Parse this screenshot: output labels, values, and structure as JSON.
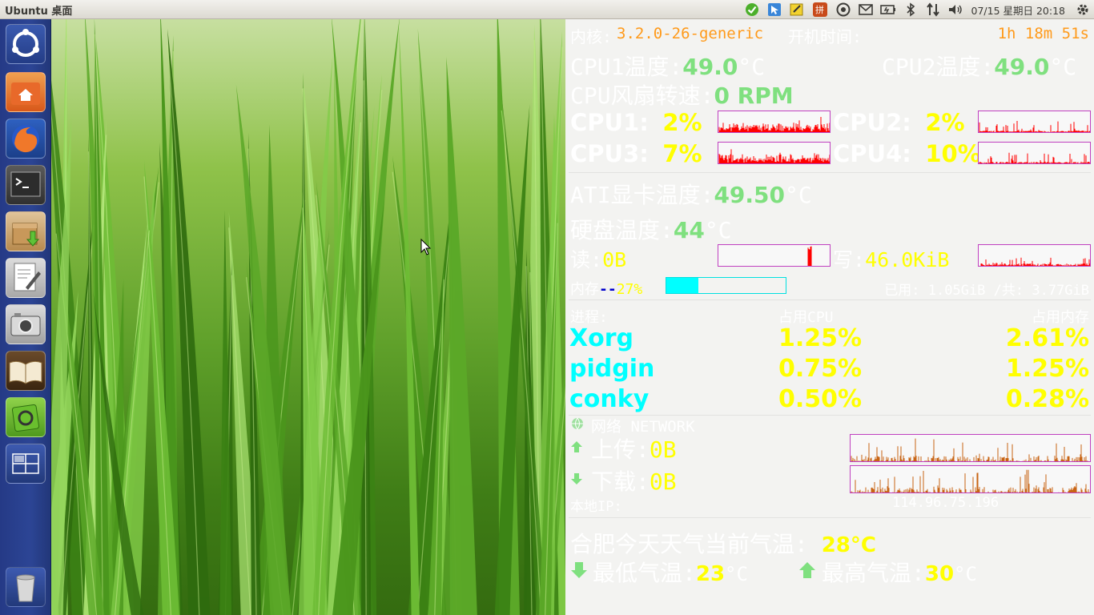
{
  "panel": {
    "title": "Ubuntu 桌面",
    "clock": "07/15 星期日 20:18",
    "tray": [
      "check-icon",
      "network-manager-icon",
      "notes-icon",
      "input-method-icon",
      "ubuntu-one-icon",
      "mail-icon",
      "battery-icon",
      "bluetooth-icon",
      "transfer-icon",
      "volume-icon",
      "power-gear-icon"
    ],
    "input_method_label": "拼"
  },
  "launcher": {
    "items": [
      "ubuntu-dash-icon",
      "home-folder-icon",
      "firefox-icon",
      "terminal-icon",
      "archive-manager-icon",
      "text-editor-icon",
      "screenshot-camera-icon",
      "ebook-reader-icon",
      "software-center-icon",
      "workspace-switcher-icon",
      "trash-icon"
    ]
  },
  "conky": {
    "kernel_label": "内核:",
    "kernel_value": "3.2.0-26-generic",
    "uptime_label": "开机时间:",
    "uptime_value": "1h 18m 51s",
    "cpu1_temp_label": "CPU1温度:",
    "cpu1_temp_value": "49.0",
    "cpu2_temp_label": "CPU2温度:",
    "cpu2_temp_value": "49.0",
    "temp_unit": "°C",
    "fan_label": "CPU风扇转速:",
    "fan_value": "0 RPM",
    "cpus": [
      {
        "label": "CPU1:",
        "value": "2%"
      },
      {
        "label": "CPU2:",
        "value": "2%"
      },
      {
        "label": "CPU3:",
        "value": "7%"
      },
      {
        "label": "CPU4:",
        "value": "10%"
      }
    ],
    "gpu_temp_label": "ATI显卡温度:",
    "gpu_temp_value": "49.50",
    "disk_temp_label": "硬盘温度:",
    "disk_temp_value": "44",
    "read_label": "读:",
    "read_value": "0B",
    "write_label": "写:",
    "write_value": "46.0KiB",
    "mem_label": "内存",
    "mem_dashes": "--",
    "mem_percent": "27%",
    "mem_fraction": 0.27,
    "mem_used": "已用: 1.05GiB /共: 3.77GiB",
    "proc_header": "进程:",
    "cpu_header": "占用CPU",
    "mem_header": "占用内存",
    "processes": [
      {
        "name": "Xorg",
        "cpu": "1.25%",
        "mem": "2.61%"
      },
      {
        "name": "pidgin",
        "cpu": "0.75%",
        "mem": "1.25%"
      },
      {
        "name": "conky",
        "cpu": "0.50%",
        "mem": "0.28%"
      }
    ],
    "network_label": "网络 NETWORK",
    "upload_label": "上传:",
    "upload_value": "0B",
    "download_label": "下载:",
    "download_value": "0B",
    "local_ip_label": "本地IP:",
    "local_ip_value": "114.96.75.196",
    "weather_label": "合肥今天天气当前气温:",
    "weather_current": "28°C",
    "weather_low_label": "最低气温:",
    "weather_low": "23",
    "weather_high_label": "最高气温:",
    "weather_high": "30",
    "colors": {
      "label": "#ffffff",
      "value_green": "#7fe07f",
      "value_yellow": "#ffff00",
      "process_cyan": "#00ffff",
      "cpu_graph": "#ff0000",
      "net_graph": "#c86414",
      "graph_border": "#c040c0"
    }
  }
}
